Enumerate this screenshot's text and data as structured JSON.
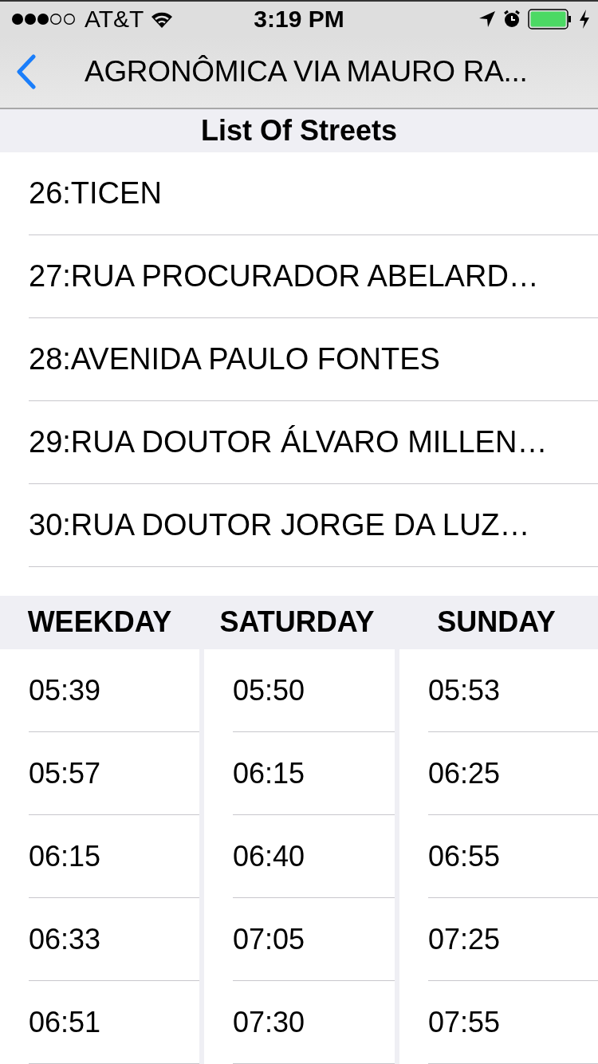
{
  "status_bar": {
    "carrier": "AT&T",
    "time": "3:19 PM"
  },
  "nav_bar": {
    "title": "AGRONÔMICA VIA MAURO RA..."
  },
  "streets_header": "List Of Streets",
  "streets": [
    "26:TICEN",
    "27:RUA PROCURADOR ABELARD…",
    "28:AVENIDA PAULO FONTES",
    "29:RUA DOUTOR ÁLVARO MILLEN…",
    "30:RUA DOUTOR JORGE DA LUZ…"
  ],
  "timetable": {
    "columns": [
      {
        "heading": "WEEKDAY",
        "times": [
          "05:39",
          "05:57",
          "06:15",
          "06:33",
          "06:51"
        ]
      },
      {
        "heading": "SATURDAY",
        "times": [
          "05:50",
          "06:15",
          "06:40",
          "07:05",
          "07:30"
        ]
      },
      {
        "heading": "SUNDAY",
        "times": [
          "05:53",
          "06:25",
          "06:55",
          "07:25",
          "07:55"
        ]
      }
    ]
  }
}
